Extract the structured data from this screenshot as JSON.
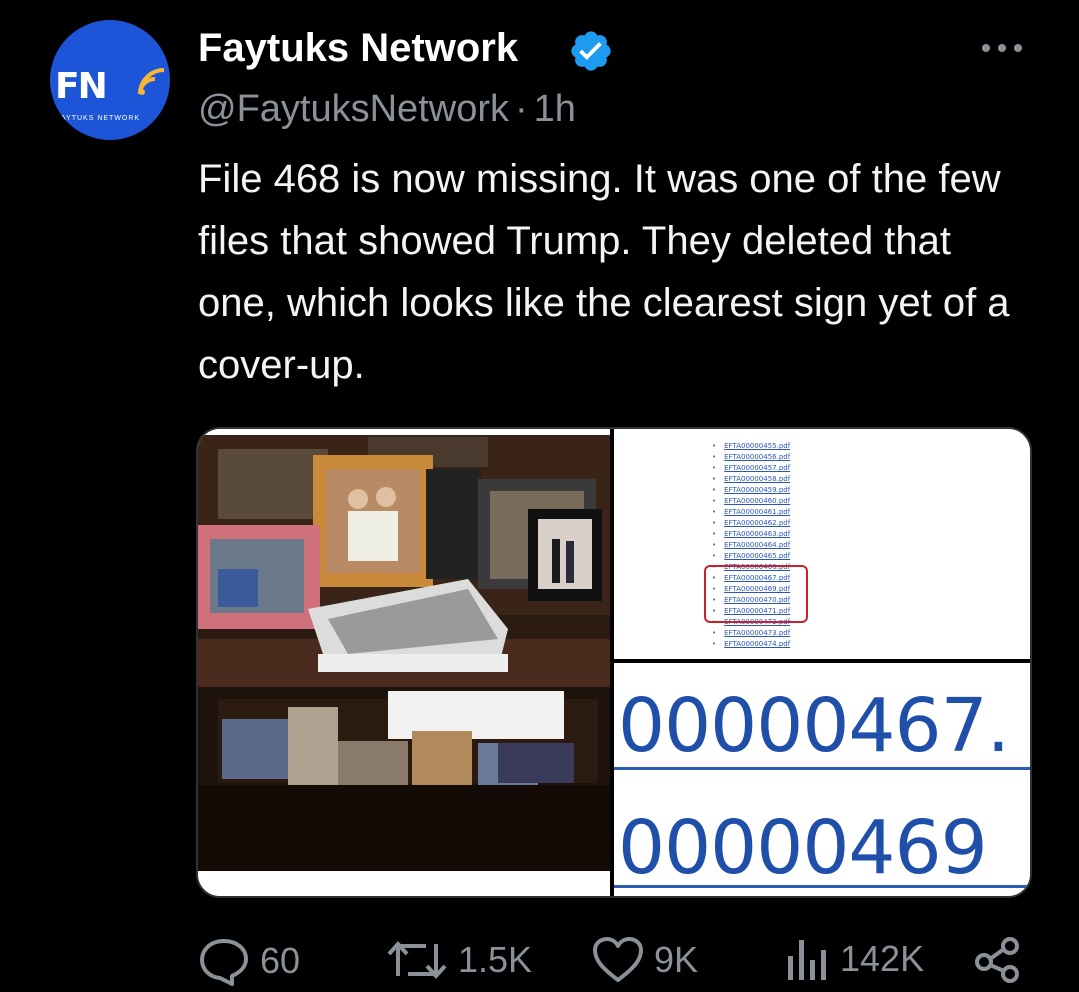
{
  "author": {
    "display_name": "Faytuks Network",
    "handle": "@FaytuksNetwork",
    "separator": "·",
    "time": "1h",
    "verified": true,
    "avatar_logo": "FN",
    "avatar_tagline": "FAYTUKS NETWORK",
    "avatar_color": "#1d55d8",
    "verified_color": "#1d9bf0"
  },
  "tweet": {
    "text": "File 468 is now missing. It was one of the few files that showed Trump. They deleted that one, which looks like the clearest sign yet of a cover-up."
  },
  "media": {
    "file_list": [
      "EFTA00000455.pdf",
      "EFTA00000456.pdf",
      "EFTA00000457.pdf",
      "EFTA00000458.pdf",
      "EFTA00000459.pdf",
      "EFTA00000460.pdf",
      "EFTA00000461.pdf",
      "EFTA00000462.pdf",
      "EFTA00000463.pdf",
      "EFTA00000464.pdf",
      "EFTA00000465.pdf",
      "EFTA00000466.pdf",
      "EFTA00000467.pdf",
      "EFTA00000469.pdf",
      "EFTA00000470.pdf",
      "EFTA00000471.pdf",
      "EFTA00000472.pdf",
      "EFTA00000473.pdf",
      "EFTA00000474.pdf"
    ],
    "zoom_numbers": [
      "00000467.",
      "00000469"
    ]
  },
  "actions": {
    "replies": "60",
    "reposts": "1.5K",
    "likes": "9K",
    "views": "142K"
  },
  "icons": {
    "more": "more-dots-icon",
    "reply": "reply-bubble-icon",
    "repost": "repost-icon",
    "like": "heart-icon",
    "views": "views-bar-icon",
    "share": "share-icon",
    "verified": "verified-badge-icon"
  }
}
